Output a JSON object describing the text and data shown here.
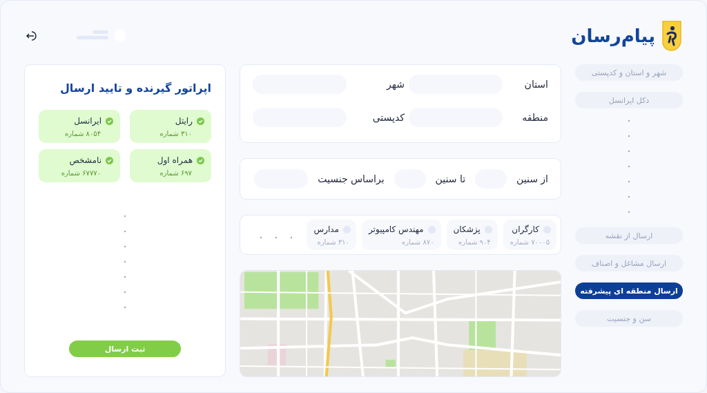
{
  "brand": {
    "name": "پیام‌رسان"
  },
  "sidebar": {
    "items": [
      {
        "label": "شهر و استان و کدپستی",
        "selected": false
      },
      {
        "label": "دکل ایرانسل",
        "selected": false
      },
      {
        "kind": "gap"
      },
      {
        "label": "ارسال از نقشه",
        "selected": false
      },
      {
        "label": "ارسال مشاغل و اصناف",
        "selected": false
      },
      {
        "label": "ارسال منطقه ای پیشرفته",
        "selected": true
      },
      {
        "label": "سن و جنسیت",
        "selected": false
      }
    ]
  },
  "location_form": {
    "fields": [
      {
        "label": "استان"
      },
      {
        "label": "شهر"
      },
      {
        "label": "منطقه"
      },
      {
        "label": "کدپستی"
      }
    ]
  },
  "age_form": {
    "fields": [
      {
        "label": "از سنین"
      },
      {
        "label": "تا سنین"
      },
      {
        "label": "براساس جنسیت"
      }
    ]
  },
  "audiences": [
    {
      "name": "کارگران",
      "count": "۷۰۰۰۵ شماره",
      "checked": false
    },
    {
      "name": "پزشکان",
      "count": "۹۰۴ شماره",
      "checked": false
    },
    {
      "name": "مهندس کامپیوتر",
      "count": "۸۷۰ شماره",
      "checked": false
    },
    {
      "name": "مدارس",
      "count": "۳۱۰ شماره",
      "checked": false
    }
  ],
  "operators_panel": {
    "title": "اپراتور گیرنده و تایید ارسال",
    "operators": [
      {
        "name": "رایتل",
        "count": "۳۱۰ شماره",
        "checked": true
      },
      {
        "name": "ایرانسل",
        "count": "۸۰۵۴ شماره",
        "checked": true
      },
      {
        "name": "همراه اول",
        "count": "۶۹۷ شماره",
        "checked": true
      },
      {
        "name": "نامشخص",
        "count": "۶۷۷۷۰ شماره",
        "checked": true
      }
    ],
    "submit": "ثبت ارسال"
  }
}
